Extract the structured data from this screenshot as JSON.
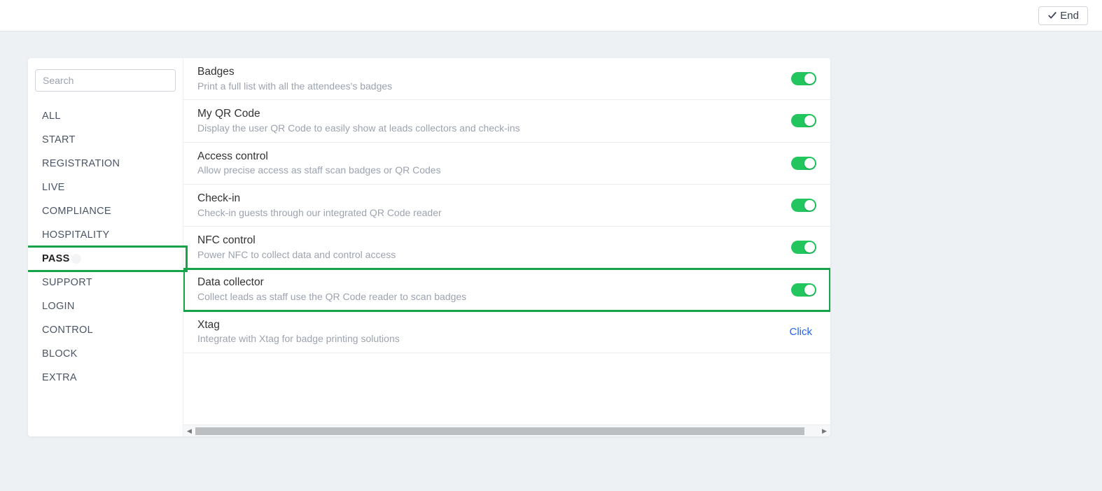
{
  "topbar": {
    "end_label": "End"
  },
  "sidebar": {
    "search_placeholder": "Search",
    "items": [
      {
        "label": "ALL",
        "active": false,
        "highlighted": false
      },
      {
        "label": "START",
        "active": false,
        "highlighted": false
      },
      {
        "label": "REGISTRATION",
        "active": false,
        "highlighted": false
      },
      {
        "label": "LIVE",
        "active": false,
        "highlighted": false
      },
      {
        "label": "COMPLIANCE",
        "active": false,
        "highlighted": false
      },
      {
        "label": "HOSPITALITY",
        "active": false,
        "highlighted": false
      },
      {
        "label": "PASS",
        "active": true,
        "highlighted": true,
        "badge": " "
      },
      {
        "label": "SUPPORT",
        "active": false,
        "highlighted": false
      },
      {
        "label": "LOGIN",
        "active": false,
        "highlighted": false
      },
      {
        "label": "CONTROL",
        "active": false,
        "highlighted": false
      },
      {
        "label": "BLOCK",
        "active": false,
        "highlighted": false
      },
      {
        "label": "EXTRA",
        "active": false,
        "highlighted": false
      }
    ]
  },
  "features": [
    {
      "title": "Badges",
      "desc": "Print a full list with all the attendees's badges",
      "action": "toggle",
      "on": true,
      "highlighted": false
    },
    {
      "title": "My QR Code",
      "desc": "Display the user QR Code to easily show at leads collectors and check-ins",
      "action": "toggle",
      "on": true,
      "highlighted": false
    },
    {
      "title": "Access control",
      "desc": "Allow precise access as staff scan badges or QR Codes",
      "action": "toggle",
      "on": true,
      "highlighted": false
    },
    {
      "title": "Check-in",
      "desc": "Check-in guests through our integrated QR Code reader",
      "action": "toggle",
      "on": true,
      "highlighted": false
    },
    {
      "title": "NFC control",
      "desc": "Power NFC to collect data and control access",
      "action": "toggle",
      "on": true,
      "highlighted": false
    },
    {
      "title": "Data collector",
      "desc": "Collect leads as staff use the QR Code reader to scan badges",
      "action": "toggle",
      "on": true,
      "highlighted": true
    },
    {
      "title": "Xtag",
      "desc": "Integrate with Xtag for badge printing solutions",
      "action": "link",
      "link_label": "Click",
      "highlighted": false
    }
  ]
}
